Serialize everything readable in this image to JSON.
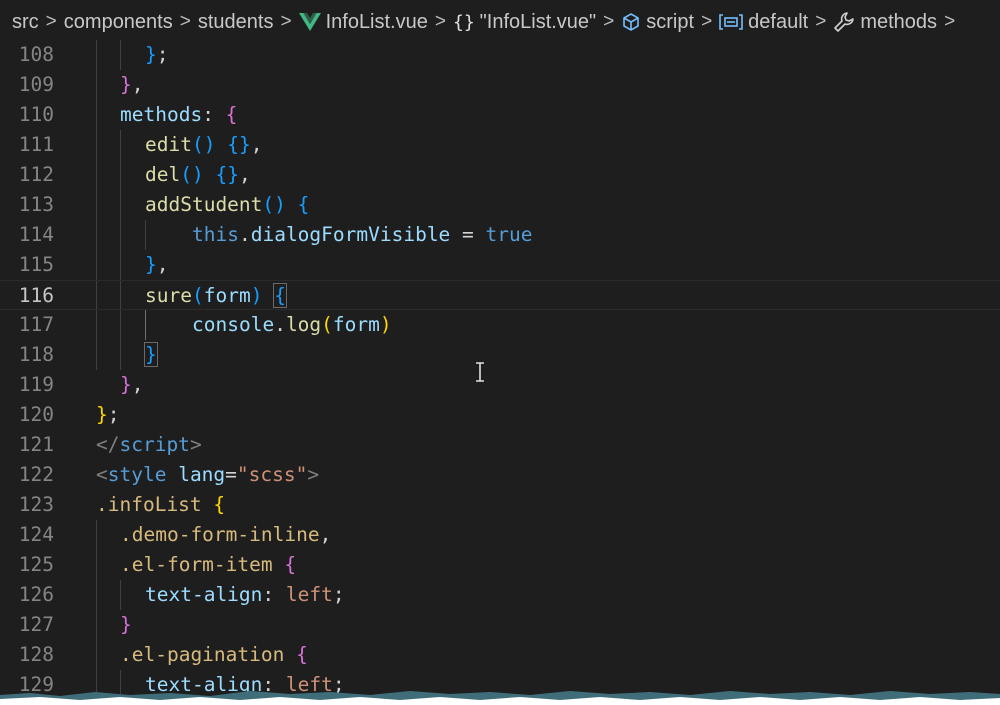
{
  "breadcrumb": {
    "items": [
      {
        "label": "src"
      },
      {
        "label": "components"
      },
      {
        "label": "students"
      },
      {
        "label": "InfoList.vue"
      },
      {
        "label": "\"InfoList.vue\""
      },
      {
        "label": "script"
      },
      {
        "label": "default"
      },
      {
        "label": "methods"
      }
    ],
    "separator": ">"
  },
  "editor": {
    "line_numbers": [
      "108",
      "109",
      "110",
      "111",
      "112",
      "113",
      "114",
      "115",
      "116",
      "117",
      "118",
      "119",
      "120",
      "121",
      "122",
      "123",
      "124",
      "125",
      "126",
      "127",
      "128",
      "129"
    ],
    "current_line": "116",
    "code": {
      "l108": {
        "brace": "}",
        "semi": ";"
      },
      "l109": {
        "brace": "}",
        "comma": ","
      },
      "l110": {
        "key": "methods",
        "colon": ": ",
        "brace": "{"
      },
      "l111": {
        "name": "edit",
        "parens": "()",
        "space": " ",
        "braces": "{}",
        "comma": ","
      },
      "l112": {
        "name": "del",
        "parens": "()",
        "space": " ",
        "braces": "{}",
        "comma": ","
      },
      "l113": {
        "name": "addStudent",
        "parens": "()",
        "space": " ",
        "brace": "{"
      },
      "l114": {
        "this": "this",
        "dot": ".",
        "prop": "dialogFormVisible",
        "eq": " = ",
        "value": "true"
      },
      "l115": {
        "brace": "}",
        "comma": ","
      },
      "l116": {
        "name": "sure",
        "open": "(",
        "param": "form",
        "close": ")",
        "space": " ",
        "brace": "{"
      },
      "l117": {
        "obj": "console",
        "dot": ".",
        "method": "log",
        "open": "(",
        "arg": "form",
        "close": ")"
      },
      "l118": {
        "brace": "}"
      },
      "l119": {
        "brace": "}",
        "comma": ","
      },
      "l120": {
        "brace": "}",
        "semi": ";"
      },
      "l121": {
        "open": "</",
        "tag": "script",
        "close": ">"
      },
      "l122": {
        "open": "<",
        "tag": "style",
        "sp": " ",
        "attr": "lang",
        "eq": "=",
        "val": "\"scss\"",
        "close": ">"
      },
      "l123": {
        "selector": ".infoList",
        "sp": " ",
        "brace": "{"
      },
      "l124": {
        "selector": ".demo-form-inline",
        "comma": ","
      },
      "l125": {
        "selector": ".el-form-item",
        "sp": " ",
        "brace": "{"
      },
      "l126": {
        "prop": "text-align",
        "colon": ": ",
        "value": "left",
        "semi": ";"
      },
      "l127": {
        "brace": "}"
      },
      "l128": {
        "selector": ".el-pagination",
        "sp": " ",
        "brace": "{"
      },
      "l129": {
        "prop": "text-align",
        "colon": ": ",
        "value": "left",
        "semi": ";"
      }
    }
  },
  "icons": {
    "vue": "vue-logo-icon",
    "braces": "braces-icon",
    "script": "cube-icon",
    "default": "symbol-variable-icon",
    "methods": "wrench-icon",
    "cursor": "text-cursor-icon"
  },
  "colors": {
    "background": "#1e1e1e",
    "keyword": "#569cd6",
    "function": "#dcdcaa",
    "property": "#9cdcfe",
    "string": "#ce9178",
    "selector": "#d7ba7d",
    "bracket_gold": "#ffd700",
    "bracket_orchid": "#da70d6",
    "bracket_blue": "#179fff"
  }
}
